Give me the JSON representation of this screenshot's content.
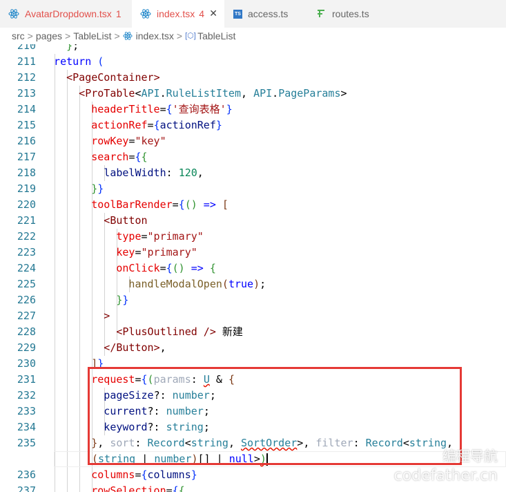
{
  "tabs": [
    {
      "label": "AvatarDropdown.tsx",
      "badge": "1",
      "icon": "react-icon",
      "label_color": "#e2504b",
      "badge_color": "#e2504b"
    },
    {
      "label": "index.tsx",
      "badge": "4",
      "icon": "react-icon",
      "label_color": "#333333",
      "badge_color": "#e2504b",
      "close": "✕"
    },
    {
      "label": "access.ts",
      "badge": "",
      "icon": "ts-icon",
      "ts_text": "TS"
    },
    {
      "label": "routes.ts",
      "badge": "",
      "icon": "route-icon"
    }
  ],
  "breadcrumb": {
    "items": [
      "src",
      "pages",
      "TableList",
      "index.tsx",
      "TableList"
    ],
    "separator": ">"
  },
  "editor": {
    "lines": [
      {
        "n": "210",
        "tokens": [
          [
            "    }",
            "t-br2"
          ],
          [
            ";",
            "t-plain"
          ]
        ]
      },
      {
        "n": "211",
        "tokens": [
          [
            "  return ",
            "t-kw"
          ],
          [
            "(",
            "t-br1"
          ]
        ]
      },
      {
        "n": "212",
        "tokens": [
          [
            "    <",
            "t-tag"
          ],
          [
            "PageContainer",
            "t-tag"
          ],
          [
            ">",
            "t-tag"
          ]
        ]
      },
      {
        "n": "213",
        "tokens": [
          [
            "      <",
            "t-tag"
          ],
          [
            "ProTable",
            "t-tag"
          ],
          [
            "<",
            "t-plain"
          ],
          [
            "API",
            "t-type"
          ],
          [
            ".",
            "t-plain"
          ],
          [
            "RuleListItem",
            "t-type"
          ],
          [
            ", ",
            "t-plain"
          ],
          [
            "API",
            "t-type"
          ],
          [
            ".",
            "t-plain"
          ],
          [
            "PageParams",
            "t-type"
          ],
          [
            ">",
            "t-plain"
          ]
        ]
      },
      {
        "n": "214",
        "tokens": [
          [
            "        headerTitle",
            "t-attr"
          ],
          [
            "=",
            "t-plain"
          ],
          [
            "{",
            "t-br1"
          ],
          [
            "'查询表格'",
            "t-str"
          ],
          [
            "}",
            "t-br1"
          ]
        ]
      },
      {
        "n": "215",
        "tokens": [
          [
            "        actionRef",
            "t-attr"
          ],
          [
            "=",
            "t-plain"
          ],
          [
            "{",
            "t-br1"
          ],
          [
            "actionRef",
            "t-var"
          ],
          [
            "}",
            "t-br1"
          ]
        ]
      },
      {
        "n": "216",
        "tokens": [
          [
            "        rowKey",
            "t-attr"
          ],
          [
            "=",
            "t-plain"
          ],
          [
            "\"key\"",
            "t-str"
          ]
        ]
      },
      {
        "n": "217",
        "tokens": [
          [
            "        search",
            "t-attr"
          ],
          [
            "=",
            "t-plain"
          ],
          [
            "{",
            "t-br1"
          ],
          [
            "{",
            "t-br2"
          ]
        ]
      },
      {
        "n": "218",
        "tokens": [
          [
            "          labelWidth",
            "t-var"
          ],
          [
            ": ",
            "t-plain"
          ],
          [
            "120",
            "t-num"
          ],
          [
            ",",
            "t-plain"
          ]
        ]
      },
      {
        "n": "219",
        "tokens": [
          [
            "        }",
            "t-br2"
          ],
          [
            "}",
            "t-br1"
          ]
        ]
      },
      {
        "n": "220",
        "tokens": [
          [
            "        toolBarRender",
            "t-attr"
          ],
          [
            "=",
            "t-plain"
          ],
          [
            "{",
            "t-br1"
          ],
          [
            "()",
            "t-br2"
          ],
          [
            " => ",
            "t-kw"
          ],
          [
            "[",
            "t-br3"
          ]
        ]
      },
      {
        "n": "221",
        "tokens": [
          [
            "          <",
            "t-tag"
          ],
          [
            "Button",
            "t-tag"
          ]
        ]
      },
      {
        "n": "222",
        "tokens": [
          [
            "            type",
            "t-attr"
          ],
          [
            "=",
            "t-plain"
          ],
          [
            "\"primary\"",
            "t-str"
          ]
        ]
      },
      {
        "n": "223",
        "tokens": [
          [
            "            key",
            "t-attr"
          ],
          [
            "=",
            "t-plain"
          ],
          [
            "\"primary\"",
            "t-str"
          ]
        ]
      },
      {
        "n": "224",
        "tokens": [
          [
            "            onClick",
            "t-attr"
          ],
          [
            "=",
            "t-plain"
          ],
          [
            "{",
            "t-br1"
          ],
          [
            "()",
            "t-br2"
          ],
          [
            " => ",
            "t-kw"
          ],
          [
            "{",
            "t-br2"
          ]
        ]
      },
      {
        "n": "225",
        "tokens": [
          [
            "              handleModalOpen",
            "t-fn"
          ],
          [
            "(",
            "t-br3"
          ],
          [
            "true",
            "t-kw"
          ],
          [
            ")",
            "t-br3"
          ],
          [
            ";",
            "t-plain"
          ]
        ]
      },
      {
        "n": "226",
        "tokens": [
          [
            "            }",
            "t-br2"
          ],
          [
            "}",
            "t-br1"
          ]
        ]
      },
      {
        "n": "227",
        "tokens": [
          [
            "          >",
            "t-tag"
          ]
        ]
      },
      {
        "n": "228",
        "tokens": [
          [
            "            <",
            "t-tag"
          ],
          [
            "PlusOutlined",
            "t-tag"
          ],
          [
            " />",
            "t-tag"
          ],
          [
            " 新建",
            "t-plain"
          ]
        ]
      },
      {
        "n": "229",
        "tokens": [
          [
            "          </",
            "t-tag"
          ],
          [
            "Button",
            "t-tag"
          ],
          [
            ">",
            "t-tag"
          ],
          [
            ",",
            "t-plain"
          ]
        ]
      },
      {
        "n": "230",
        "tokens": [
          [
            "        ]",
            "t-br3"
          ],
          [
            "}",
            "t-br1"
          ]
        ]
      },
      {
        "n": "231",
        "tokens": [
          [
            "        request",
            "t-attr"
          ],
          [
            "=",
            "t-plain"
          ],
          [
            "{",
            "t-br1"
          ],
          [
            "(",
            "t-br2"
          ],
          [
            "params",
            "t-dim"
          ],
          [
            ": ",
            "t-plain"
          ],
          [
            "U",
            "t-type squig"
          ],
          [
            " & ",
            "t-plain"
          ],
          [
            "{",
            "t-br3"
          ]
        ]
      },
      {
        "n": "232",
        "tokens": [
          [
            "          pageSize",
            "t-var"
          ],
          [
            "?: ",
            "t-plain"
          ],
          [
            "number",
            "t-type"
          ],
          [
            ";",
            "t-plain"
          ]
        ]
      },
      {
        "n": "233",
        "tokens": [
          [
            "          current",
            "t-var"
          ],
          [
            "?: ",
            "t-plain"
          ],
          [
            "number",
            "t-type"
          ],
          [
            ";",
            "t-plain"
          ]
        ]
      },
      {
        "n": "234",
        "tokens": [
          [
            "          keyword",
            "t-var"
          ],
          [
            "?: ",
            "t-plain"
          ],
          [
            "string",
            "t-type"
          ],
          [
            ";",
            "t-plain"
          ]
        ]
      },
      {
        "n": "235",
        "tokens": [
          [
            "        }",
            "t-br3"
          ],
          [
            ", ",
            "t-plain"
          ],
          [
            "sort",
            "t-dim"
          ],
          [
            ": ",
            "t-plain"
          ],
          [
            "Record",
            "t-type"
          ],
          [
            "<",
            "t-plain"
          ],
          [
            "string",
            "t-type"
          ],
          [
            ", ",
            "t-plain"
          ],
          [
            "SortOrder",
            "t-type squig"
          ],
          [
            ">",
            "t-plain"
          ],
          [
            ", ",
            "t-plain"
          ],
          [
            "filter",
            "t-dim"
          ],
          [
            ": ",
            "t-plain"
          ],
          [
            "Record",
            "t-type"
          ],
          [
            "<",
            "t-plain"
          ],
          [
            "string",
            "t-type"
          ],
          [
            ",",
            "t-plain"
          ]
        ]
      },
      {
        "n": "",
        "tokens": [
          [
            "(",
            "t-br3"
          ],
          [
            "string",
            "t-type"
          ],
          [
            " | ",
            "t-plain"
          ],
          [
            "number",
            "t-type"
          ],
          [
            ")",
            "t-br3"
          ],
          [
            "[]",
            "t-plain"
          ],
          [
            " | ",
            "t-plain"
          ],
          [
            "null",
            "t-kw"
          ],
          [
            ">",
            "t-plain"
          ],
          [
            ")",
            "t-br2 squig"
          ]
        ]
      },
      {
        "n": "236",
        "tokens": [
          [
            "        columns",
            "t-attr"
          ],
          [
            "=",
            "t-plain"
          ],
          [
            "{",
            "t-br1"
          ],
          [
            "columns",
            "t-var"
          ],
          [
            "}",
            "t-br1"
          ]
        ]
      },
      {
        "n": "237",
        "tokens": [
          [
            "        rowSelection",
            "t-attr"
          ],
          [
            "=",
            "t-plain"
          ],
          [
            "{",
            "t-br1"
          ],
          [
            "{",
            "t-br2"
          ]
        ]
      }
    ]
  },
  "watermark": {
    "line1": "编程导航",
    "line2": "codefather.cn"
  }
}
